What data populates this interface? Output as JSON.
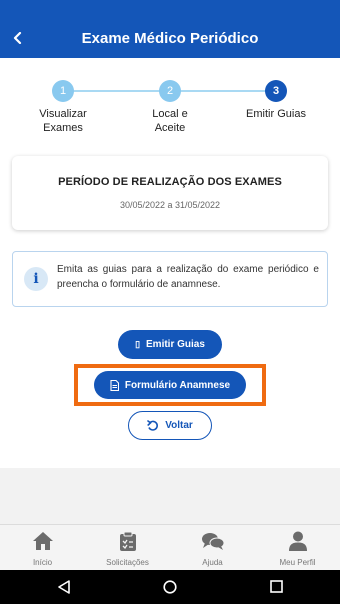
{
  "header": {
    "title": "Exame Médico Periódico"
  },
  "stepper": {
    "steps": [
      {
        "number": "1",
        "label_line1": "Visualizar",
        "label_line2": "Exames"
      },
      {
        "number": "2",
        "label_line1": "Local e",
        "label_line2": "Aceite"
      },
      {
        "number": "3",
        "label_line1": "Emitir Guias",
        "label_line2": ""
      }
    ],
    "active_step": 3
  },
  "period": {
    "title": "PERÍODO DE REALIZAÇÃO DOS EXAMES",
    "dates": "30/05/2022 a 31/05/2022"
  },
  "info": {
    "text": "Emita as guias para a realização do exame periódico e preencha o formulário de anamnese."
  },
  "buttons": {
    "emitir_guias": "Emitir Guias",
    "formulario_anamnese": "Formulário Anamnese",
    "voltar": "Voltar"
  },
  "tabbar": {
    "items": [
      {
        "label": "Início",
        "icon": "home-icon"
      },
      {
        "label": "Solicitações",
        "icon": "clipboard-icon"
      },
      {
        "label": "Ajuda",
        "icon": "chat-icon"
      },
      {
        "label": "Meu Perfil",
        "icon": "user-icon"
      }
    ]
  },
  "colors": {
    "primary": "#1456b8",
    "step_light": "#89c9ef",
    "highlight": "#ef6b11"
  }
}
